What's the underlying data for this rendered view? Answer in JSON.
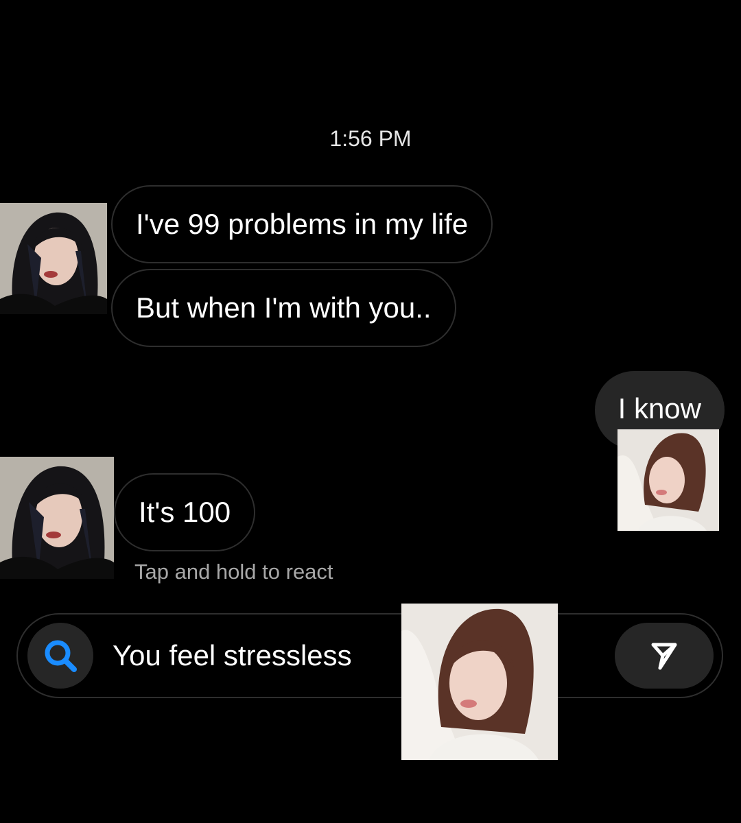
{
  "thread": {
    "timestamp": "1:56 PM",
    "messages": [
      {
        "sender": "them",
        "text": "I've 99 problems in my life"
      },
      {
        "sender": "them",
        "text": "But when I'm with you.."
      },
      {
        "sender": "me",
        "text": "I know"
      },
      {
        "sender": "them",
        "text": "It's 100"
      }
    ],
    "react_hint": "Tap and hold to react"
  },
  "composer": {
    "text": "You feel stressless",
    "search_icon": "search-icon",
    "send_icon": "send-icon"
  },
  "colors": {
    "background": "#000000",
    "incoming_border": "#2e2e2e",
    "outgoing_bubble": "#262626",
    "search_accent": "#1a8cff",
    "hint_text": "#a8a8a8"
  }
}
